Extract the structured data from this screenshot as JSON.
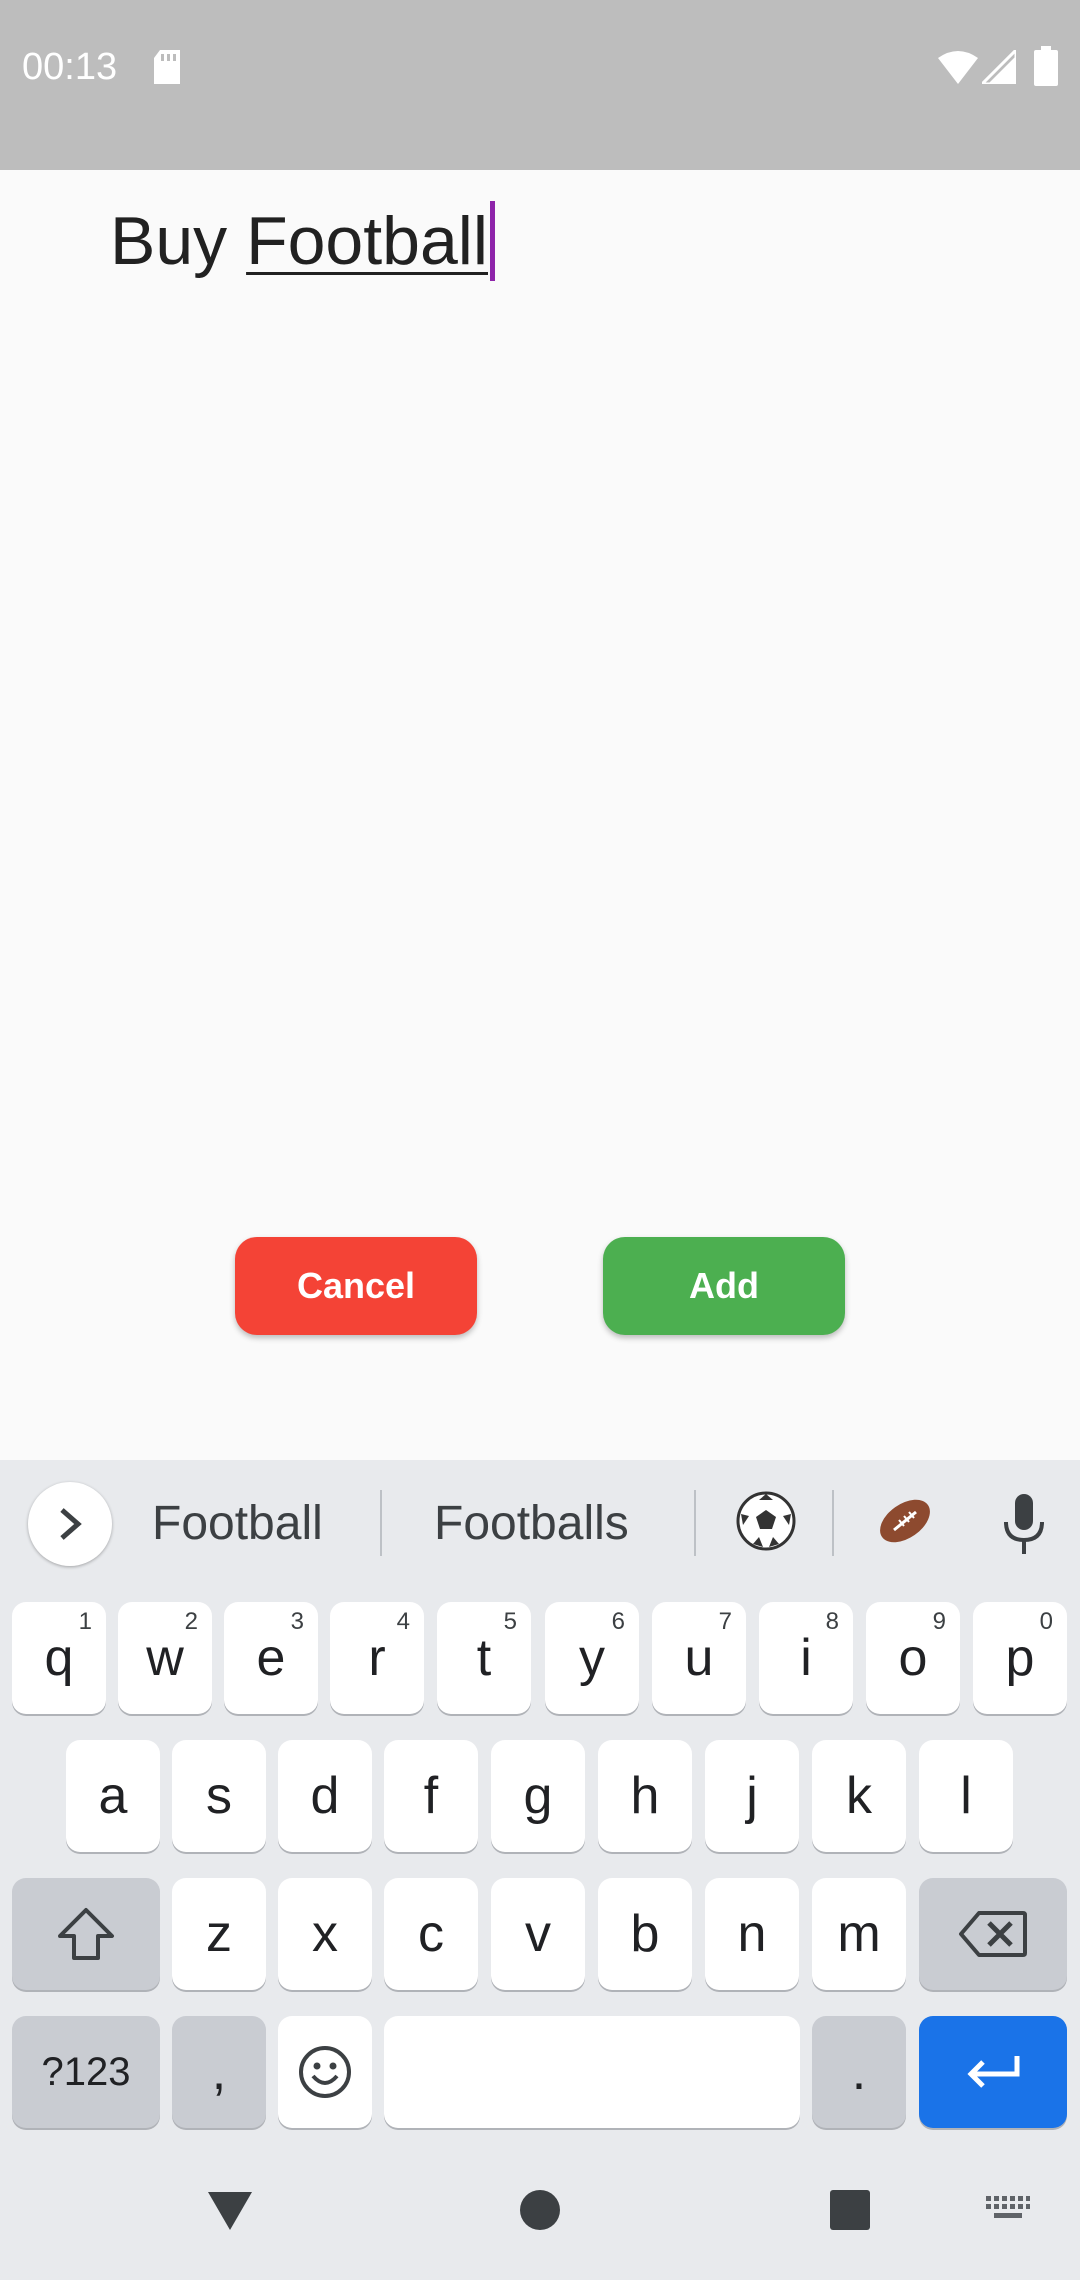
{
  "status_bar": {
    "time": "00:13"
  },
  "editor": {
    "text_prefix": "Buy ",
    "text_composing": "Football"
  },
  "buttons": {
    "cancel": "Cancel",
    "add": "Add"
  },
  "keyboard": {
    "suggestions": [
      "Football",
      "Footballs"
    ],
    "emoji_suggestions": [
      "soccer-ball",
      "american-football"
    ],
    "row1": [
      {
        "label": "q",
        "hint": "1"
      },
      {
        "label": "w",
        "hint": "2"
      },
      {
        "label": "e",
        "hint": "3"
      },
      {
        "label": "r",
        "hint": "4"
      },
      {
        "label": "t",
        "hint": "5"
      },
      {
        "label": "y",
        "hint": "6"
      },
      {
        "label": "u",
        "hint": "7"
      },
      {
        "label": "i",
        "hint": "8"
      },
      {
        "label": "o",
        "hint": "9"
      },
      {
        "label": "p",
        "hint": "0"
      }
    ],
    "row2": [
      "a",
      "s",
      "d",
      "f",
      "g",
      "h",
      "j",
      "k",
      "l"
    ],
    "row3": [
      "z",
      "x",
      "c",
      "v",
      "b",
      "n",
      "m"
    ],
    "symbols_key": "?123",
    "comma_key": ",",
    "period_key": "."
  },
  "colors": {
    "cancel": "#f44336",
    "add": "#4caf50",
    "caret": "#8e24aa",
    "enter": "#1a73e8"
  }
}
